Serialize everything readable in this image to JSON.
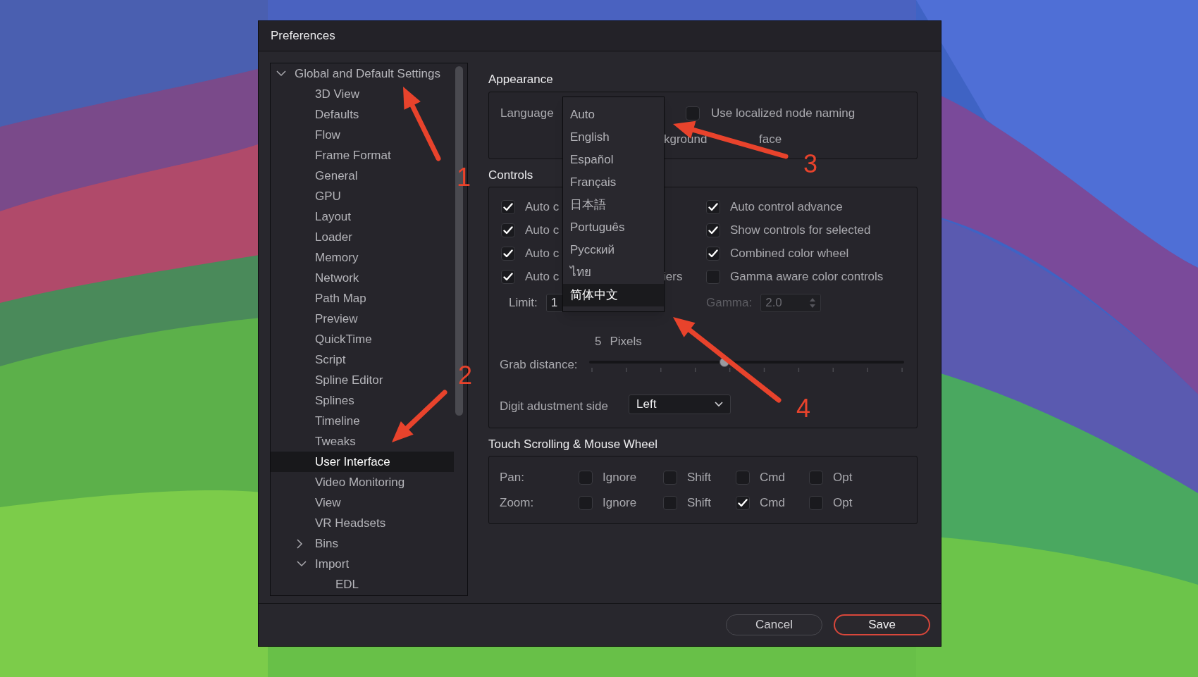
{
  "window": {
    "title": "Preferences"
  },
  "tree": [
    {
      "label": "Global and Default Settings",
      "expanded": true,
      "selected": false,
      "children": [
        {
          "label": "3D View",
          "selected": false
        },
        {
          "label": "Defaults",
          "selected": false
        },
        {
          "label": "Flow",
          "selected": false
        },
        {
          "label": "Frame Format",
          "selected": false
        },
        {
          "label": "General",
          "selected": false
        },
        {
          "label": "GPU",
          "selected": false
        },
        {
          "label": "Layout",
          "selected": false
        },
        {
          "label": "Loader",
          "selected": false
        },
        {
          "label": "Memory",
          "selected": false
        },
        {
          "label": "Network",
          "selected": false
        },
        {
          "label": "Path Map",
          "selected": false
        },
        {
          "label": "Preview",
          "selected": false
        },
        {
          "label": "QuickTime",
          "selected": false
        },
        {
          "label": "Script",
          "selected": false
        },
        {
          "label": "Spline Editor",
          "selected": false
        },
        {
          "label": "Splines",
          "selected": false
        },
        {
          "label": "Timeline",
          "selected": false
        },
        {
          "label": "Tweaks",
          "selected": false
        },
        {
          "label": "User Interface",
          "selected": true
        },
        {
          "label": "Video Monitoring",
          "selected": false
        },
        {
          "label": "View",
          "selected": false
        },
        {
          "label": "VR Headsets",
          "selected": false
        },
        {
          "label": "Bins",
          "expanded": false,
          "selected": false
        },
        {
          "label": "Import",
          "expanded": true,
          "selected": false,
          "children": [
            {
              "label": "EDL",
              "selected": false
            }
          ]
        }
      ]
    }
  ],
  "appearance": {
    "title": "Appearance",
    "language_label": "Language",
    "language_options": [
      {
        "label": "Auto",
        "selected": false
      },
      {
        "label": "English",
        "selected": false
      },
      {
        "label": "Español",
        "selected": false
      },
      {
        "label": "Français",
        "selected": false
      },
      {
        "label": "日本語",
        "selected": false
      },
      {
        "label": "Português",
        "selected": false
      },
      {
        "label": "Русский",
        "selected": false
      },
      {
        "label": "ไทย",
        "selected": false
      },
      {
        "label": "简体中文",
        "selected": true
      }
    ],
    "localized_naming": {
      "label": "Use localized node naming",
      "checked": false
    },
    "partial_text": [
      "kground",
      "face"
    ]
  },
  "controls": {
    "title": "Controls",
    "left": [
      {
        "label": "Auto c",
        "checked": true
      },
      {
        "label": "Auto c",
        "checked": true
      },
      {
        "label": "Auto c",
        "checked": true
      },
      {
        "label": "Auto c",
        "tail": "iers",
        "checked": true
      }
    ],
    "right": [
      {
        "label": "Auto control advance",
        "checked": true
      },
      {
        "label": "Show controls for selected",
        "checked": true
      },
      {
        "label": "Combined color wheel",
        "checked": true
      },
      {
        "label": "Gamma aware color controls",
        "checked": false
      }
    ],
    "limit": {
      "label": "Limit:",
      "value": "1"
    },
    "gamma": {
      "label": "Gamma:",
      "value": "2.0",
      "disabled": true
    },
    "grab": {
      "reading": "5",
      "unit": "Pixels",
      "label": "Grab distance:",
      "level": 0.43
    },
    "digit_side": {
      "label": "Digit adustment side",
      "value": "Left"
    }
  },
  "scrolling": {
    "title": "Touch Scrolling & Mouse Wheel",
    "rows": [
      {
        "label": "Pan:",
        "options": [
          {
            "label": "Ignore",
            "checked": false
          },
          {
            "label": "Shift",
            "checked": false
          },
          {
            "label": "Cmd",
            "checked": false
          },
          {
            "label": "Opt",
            "checked": false
          }
        ]
      },
      {
        "label": "Zoom:",
        "options": [
          {
            "label": "Ignore",
            "checked": false
          },
          {
            "label": "Shift",
            "checked": false
          },
          {
            "label": "Cmd",
            "checked": true
          },
          {
            "label": "Opt",
            "checked": false
          }
        ]
      }
    ]
  },
  "buttons": [
    {
      "label": "Cancel",
      "kind": "normal"
    },
    {
      "label": "Save",
      "kind": "default"
    }
  ],
  "annotations": [
    {
      "number": "1"
    },
    {
      "number": "2"
    },
    {
      "number": "3"
    },
    {
      "number": "4"
    }
  ]
}
